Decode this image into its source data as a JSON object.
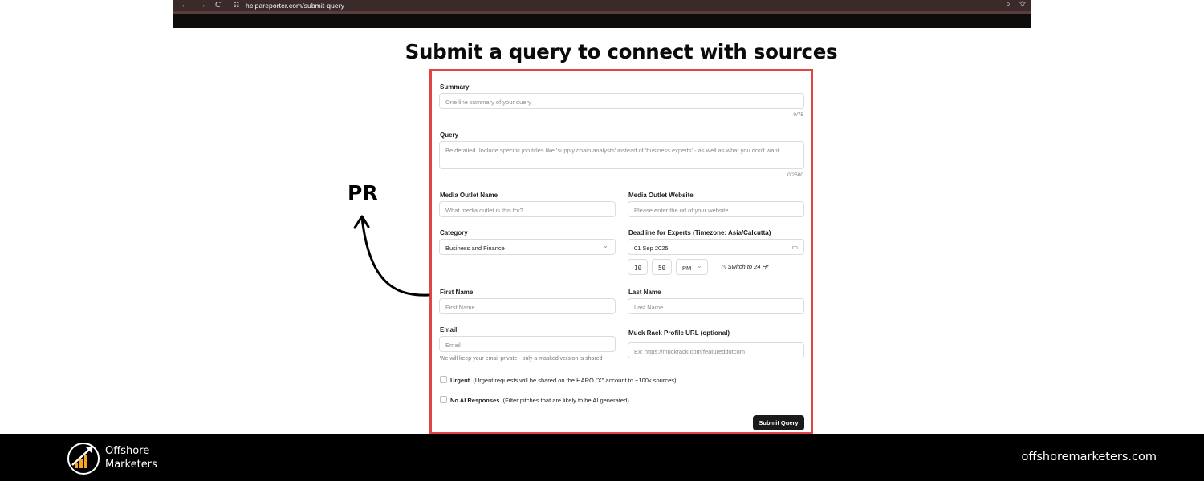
{
  "browser": {
    "url": "helpareporter.com/submit-query",
    "back_icon": "←",
    "forward_icon": "→",
    "reload_icon": "C",
    "site_info_icon": "☷",
    "zoom_icon": "⌕",
    "star_icon": "☆"
  },
  "page": {
    "title": "Submit a query to connect with sources"
  },
  "form": {
    "summary": {
      "label": "Summary",
      "placeholder": "One line summary of your query",
      "counter": "0/75"
    },
    "query": {
      "label": "Query",
      "placeholder": "Be detailed. Include specific job titles like 'supply chain analysts' instead of 'business experts' - as well as what you don't want.",
      "counter": "0/2500"
    },
    "media_outlet_name": {
      "label": "Media Outlet Name",
      "placeholder": "What media outlet is this for?"
    },
    "media_outlet_website": {
      "label": "Media Outlet Website",
      "placeholder": "Please enter the url of your website"
    },
    "category": {
      "label": "Category",
      "value": "Business and Finance",
      "chevron": "⌄"
    },
    "deadline": {
      "label": "Deadline for Experts (Timezone: Asia/Calcutta)",
      "date": "01 Sep 2025",
      "calendar_icon": "▭",
      "hour": "10",
      "minute": "50",
      "ampm": "PM",
      "ampm_chevron": "⌄",
      "switch_label": "Switch to 24 Hr",
      "clock_icon": "◷"
    },
    "first_name": {
      "label": "First Name",
      "placeholder": "First Name"
    },
    "last_name": {
      "label": "Last Name",
      "placeholder": "Last Name"
    },
    "email": {
      "label": "Email",
      "placeholder": "Email",
      "note": "We will keep your email private - only a masked version is shared"
    },
    "muck_rack": {
      "label": "Muck Rack Profile URL (optional)",
      "placeholder": "Ex: https://muckrack.com/featureddotcom"
    },
    "urgent": {
      "label": "Urgent",
      "desc": "(Urgent requests will be shared on the HARO \"X\" account to ~100k sources)"
    },
    "no_ai": {
      "label": "No AI Responses",
      "desc": "(Filter pitches that are likely to be AI generated)"
    },
    "submit_label": "Submit Query"
  },
  "annotation": {
    "text": "PR"
  },
  "footer": {
    "brand_line1": "Offshore",
    "brand_line2": "Marketers",
    "url": "offshoremarketers.com"
  },
  "colors": {
    "highlight_border": "#e04444",
    "footer_bg": "#000000",
    "logo_accent": "#f5a623",
    "button_bg": "#1a1a1a"
  }
}
